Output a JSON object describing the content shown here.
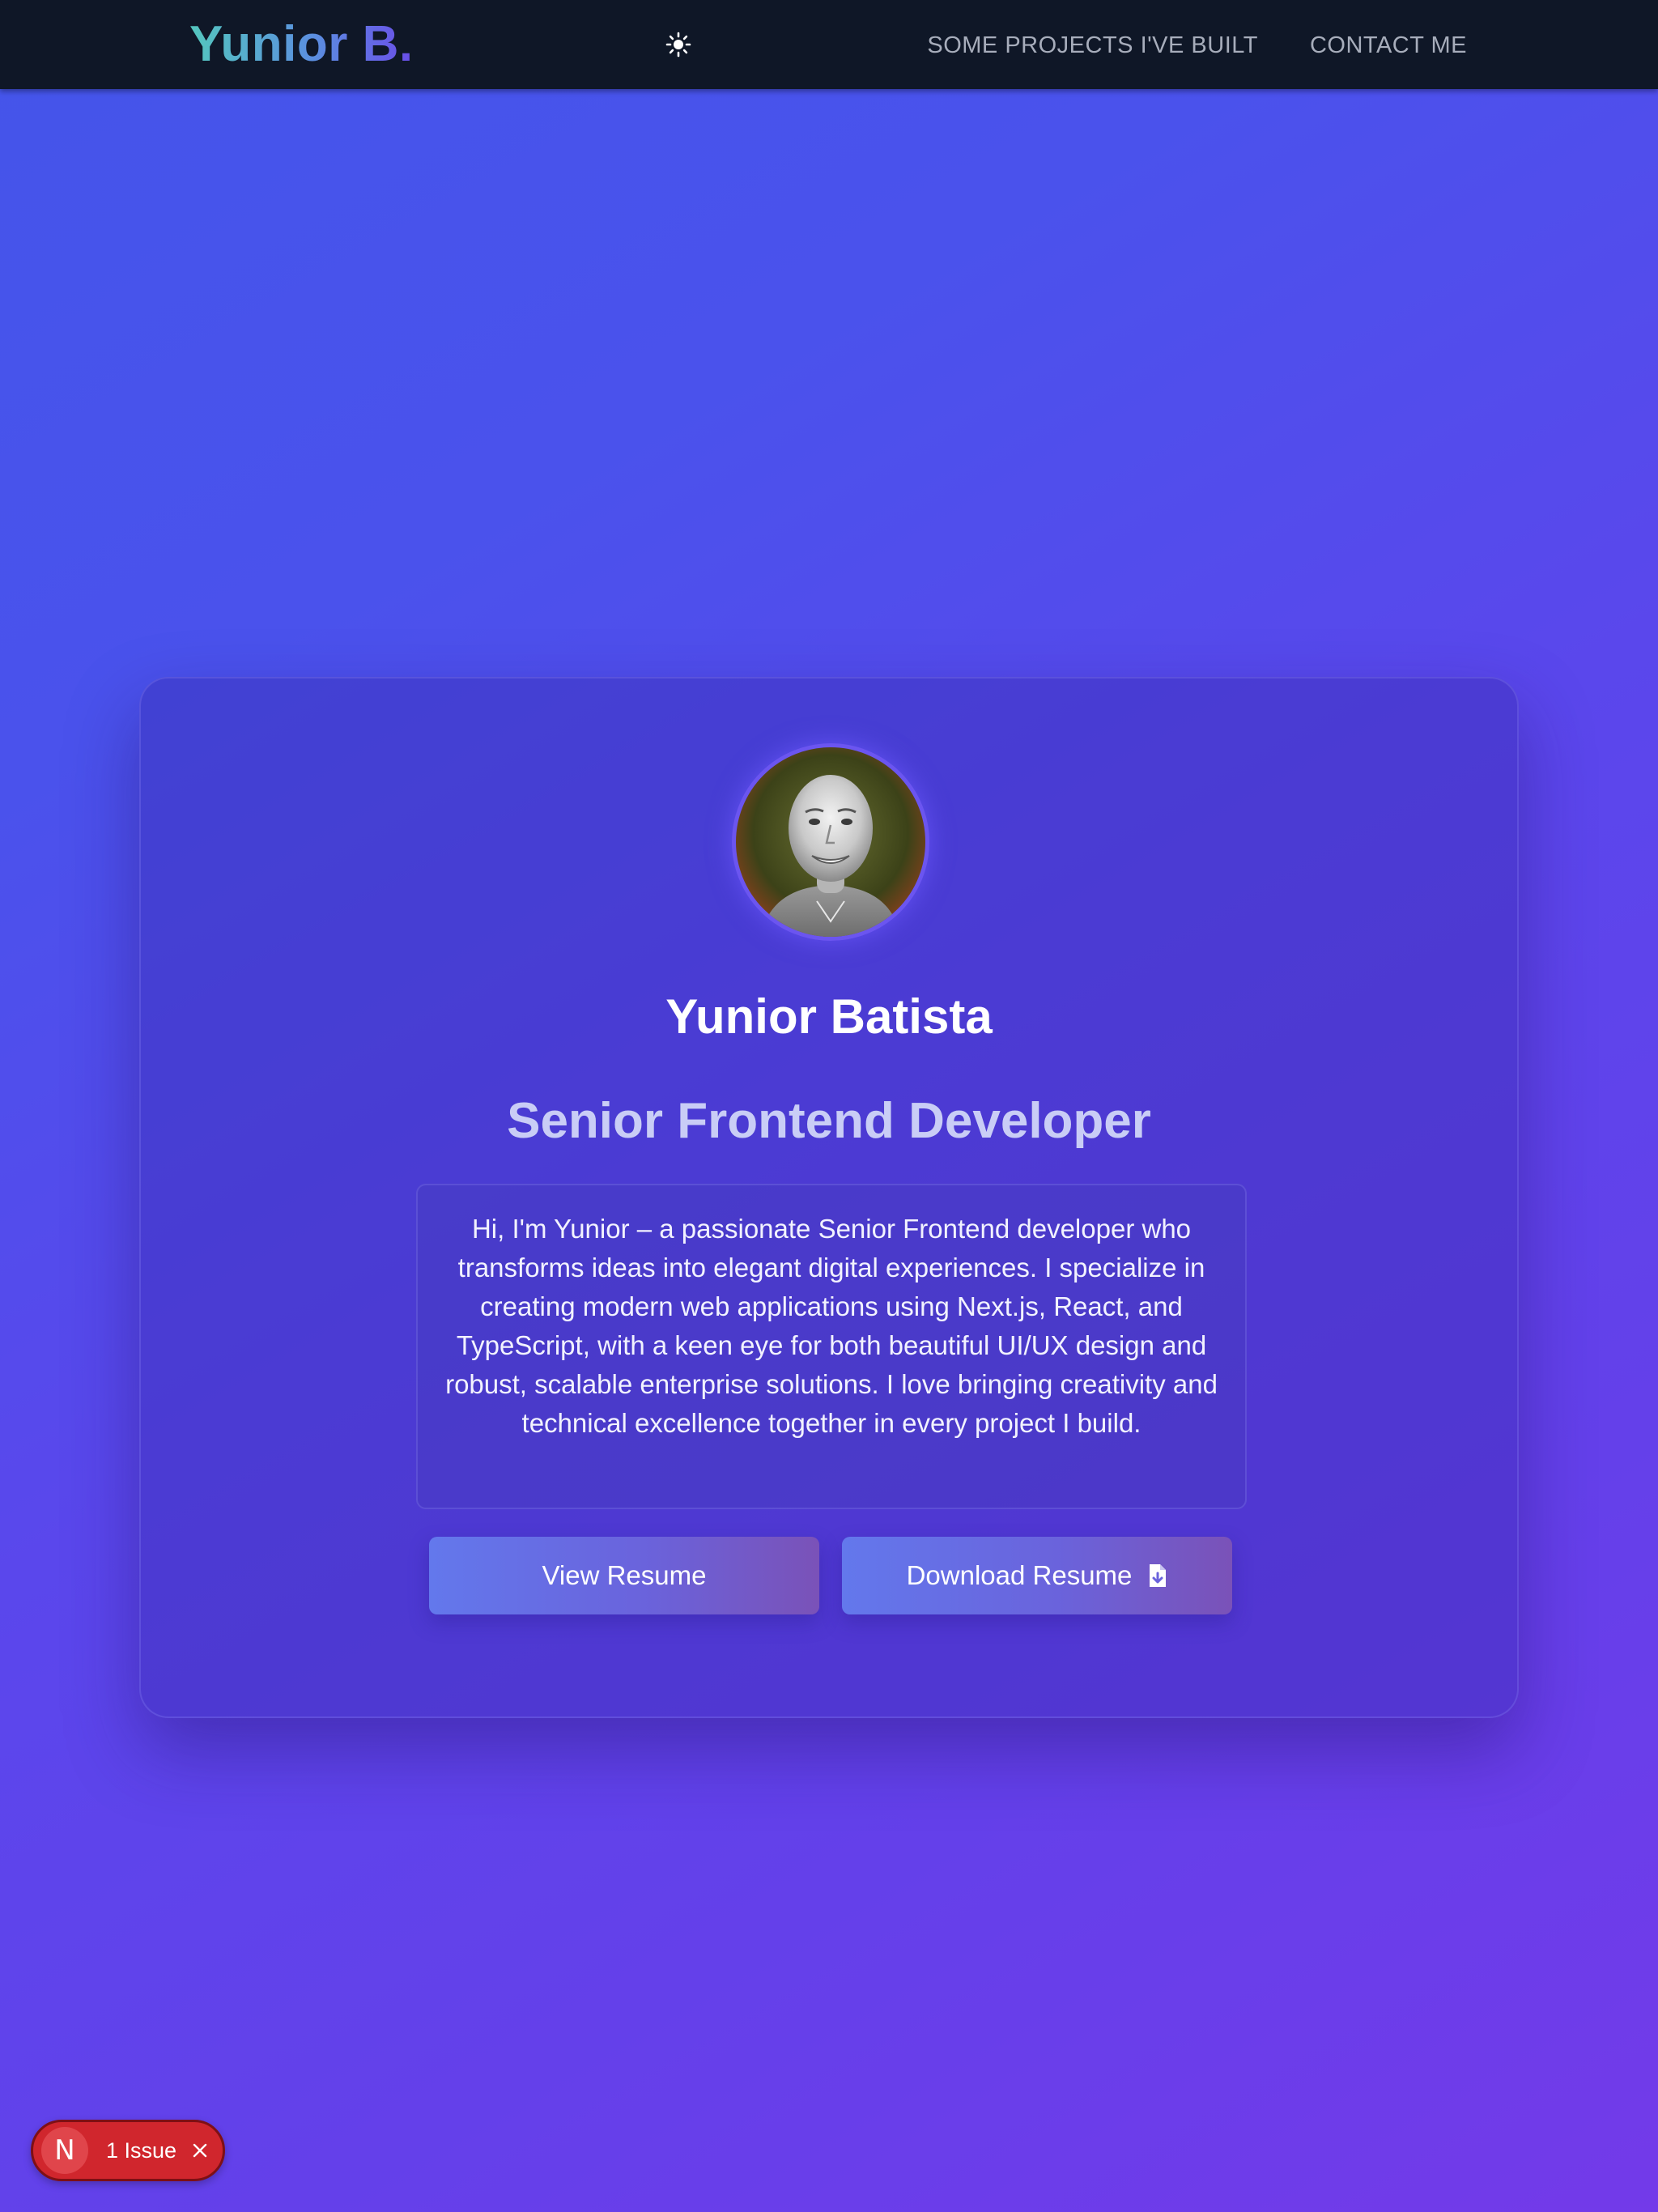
{
  "header": {
    "logo": "Yunior B.",
    "theme_toggle_icon": "sun-icon",
    "nav": [
      {
        "label": "SOME PROJECTS I'VE BUILT"
      },
      {
        "label": "CONTACT ME"
      }
    ]
  },
  "profile": {
    "avatar": "profile-photo",
    "name": "Yunior Batista",
    "role": "Senior Frontend Developer",
    "bio": "Hi, I'm Yunior – a passionate Senior Frontend developer who transforms ideas into elegant digital experiences. I specialize in creating modern web applications using Next.js, React, and TypeScript, with a keen eye for both beautiful UI/UX design and robust, scalable enterprise solutions. I love bringing creativity and technical excellence together in every project I build."
  },
  "actions": {
    "view_label": "View Resume",
    "download_label": "Download Resume",
    "download_icon": "file-download-icon"
  },
  "dev_overlay": {
    "badge_letter": "N",
    "label": "1 Issue",
    "close_icon": "close-icon"
  },
  "colors": {
    "navbar": "#0f1727",
    "logo_gradient_start": "#54c6be",
    "logo_gradient_end": "#6a4de8",
    "issue_red": "#d0262d"
  }
}
